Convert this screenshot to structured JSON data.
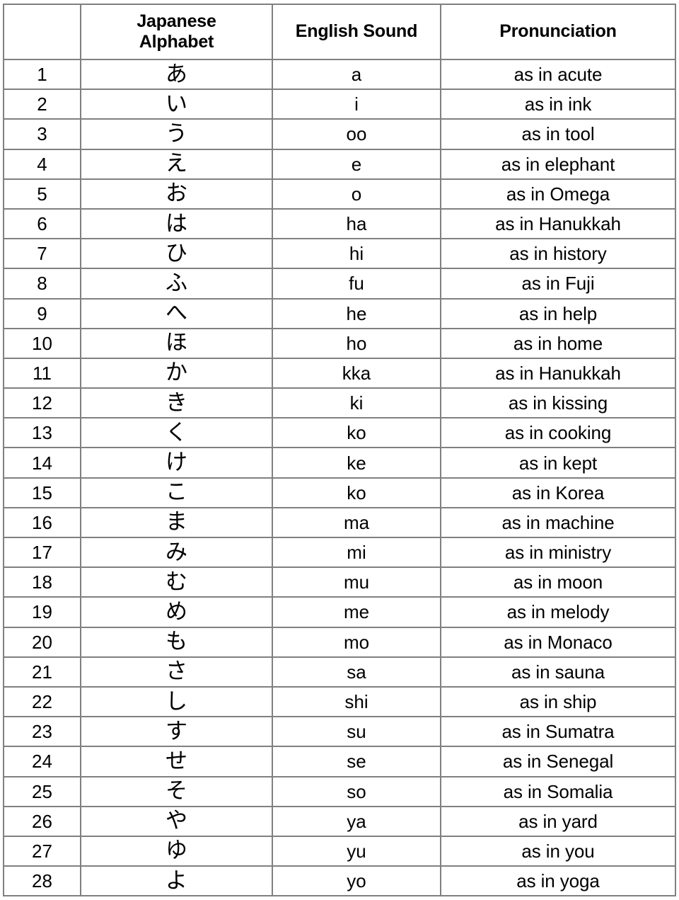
{
  "table": {
    "columns": [
      {
        "key": "index",
        "label": ""
      },
      {
        "key": "kana",
        "label": "Japanese Alphabet",
        "label_line1": "Japanese",
        "label_line2": "Alphabet"
      },
      {
        "key": "sound",
        "label": "English Sound"
      },
      {
        "key": "pron",
        "label": "Pronunciation"
      }
    ],
    "rows": [
      {
        "index": "1",
        "kana": "あ",
        "sound": "a",
        "pron": "as in acute"
      },
      {
        "index": "2",
        "kana": "い",
        "sound": "i",
        "pron": "as in ink"
      },
      {
        "index": "3",
        "kana": "う",
        "sound": "oo",
        "pron": "as in tool"
      },
      {
        "index": "4",
        "kana": "え",
        "sound": "e",
        "pron": "as in elephant"
      },
      {
        "index": "5",
        "kana": "お",
        "sound": "o",
        "pron": "as in Omega"
      },
      {
        "index": "6",
        "kana": "は",
        "sound": "ha",
        "pron": "as in Hanukkah"
      },
      {
        "index": "7",
        "kana": "ひ",
        "sound": "hi",
        "pron": "as in history"
      },
      {
        "index": "8",
        "kana": "ふ",
        "sound": "fu",
        "pron": "as in Fuji"
      },
      {
        "index": "9",
        "kana": "へ",
        "sound": "he",
        "pron": "as in help"
      },
      {
        "index": "10",
        "kana": "ほ",
        "sound": "ho",
        "pron": "as in home"
      },
      {
        "index": "11",
        "kana": "か",
        "sound": "kka",
        "pron": "as in Hanukkah"
      },
      {
        "index": "12",
        "kana": "き",
        "sound": "ki",
        "pron": "as in kissing"
      },
      {
        "index": "13",
        "kana": "く",
        "sound": "ko",
        "pron": "as in cooking"
      },
      {
        "index": "14",
        "kana": "け",
        "sound": "ke",
        "pron": "as in kept"
      },
      {
        "index": "15",
        "kana": "こ",
        "sound": "ko",
        "pron": "as in Korea"
      },
      {
        "index": "16",
        "kana": "ま",
        "sound": "ma",
        "pron": "as in machine"
      },
      {
        "index": "17",
        "kana": "み",
        "sound": "mi",
        "pron": "as in ministry"
      },
      {
        "index": "18",
        "kana": "む",
        "sound": "mu",
        "pron": "as in moon"
      },
      {
        "index": "19",
        "kana": "め",
        "sound": "me",
        "pron": "as in melody"
      },
      {
        "index": "20",
        "kana": "も",
        "sound": "mo",
        "pron": "as in Monaco"
      },
      {
        "index": "21",
        "kana": "さ",
        "sound": "sa",
        "pron": "as in sauna"
      },
      {
        "index": "22",
        "kana": "し",
        "sound": "shi",
        "pron": "as in ship"
      },
      {
        "index": "23",
        "kana": "す",
        "sound": "su",
        "pron": "as in Sumatra"
      },
      {
        "index": "24",
        "kana": "せ",
        "sound": "se",
        "pron": "as in Senegal"
      },
      {
        "index": "25",
        "kana": "そ",
        "sound": "so",
        "pron": "as in Somalia"
      },
      {
        "index": "26",
        "kana": "や",
        "sound": "ya",
        "pron": "as in yard"
      },
      {
        "index": "27",
        "kana": "ゆ",
        "sound": "yu",
        "pron": "as in you"
      },
      {
        "index": "28",
        "kana": "よ",
        "sound": "yo",
        "pron": "as in yoga"
      }
    ]
  },
  "style": {
    "border_color": "#808080",
    "text_color": "#000000",
    "background": "#ffffff"
  }
}
